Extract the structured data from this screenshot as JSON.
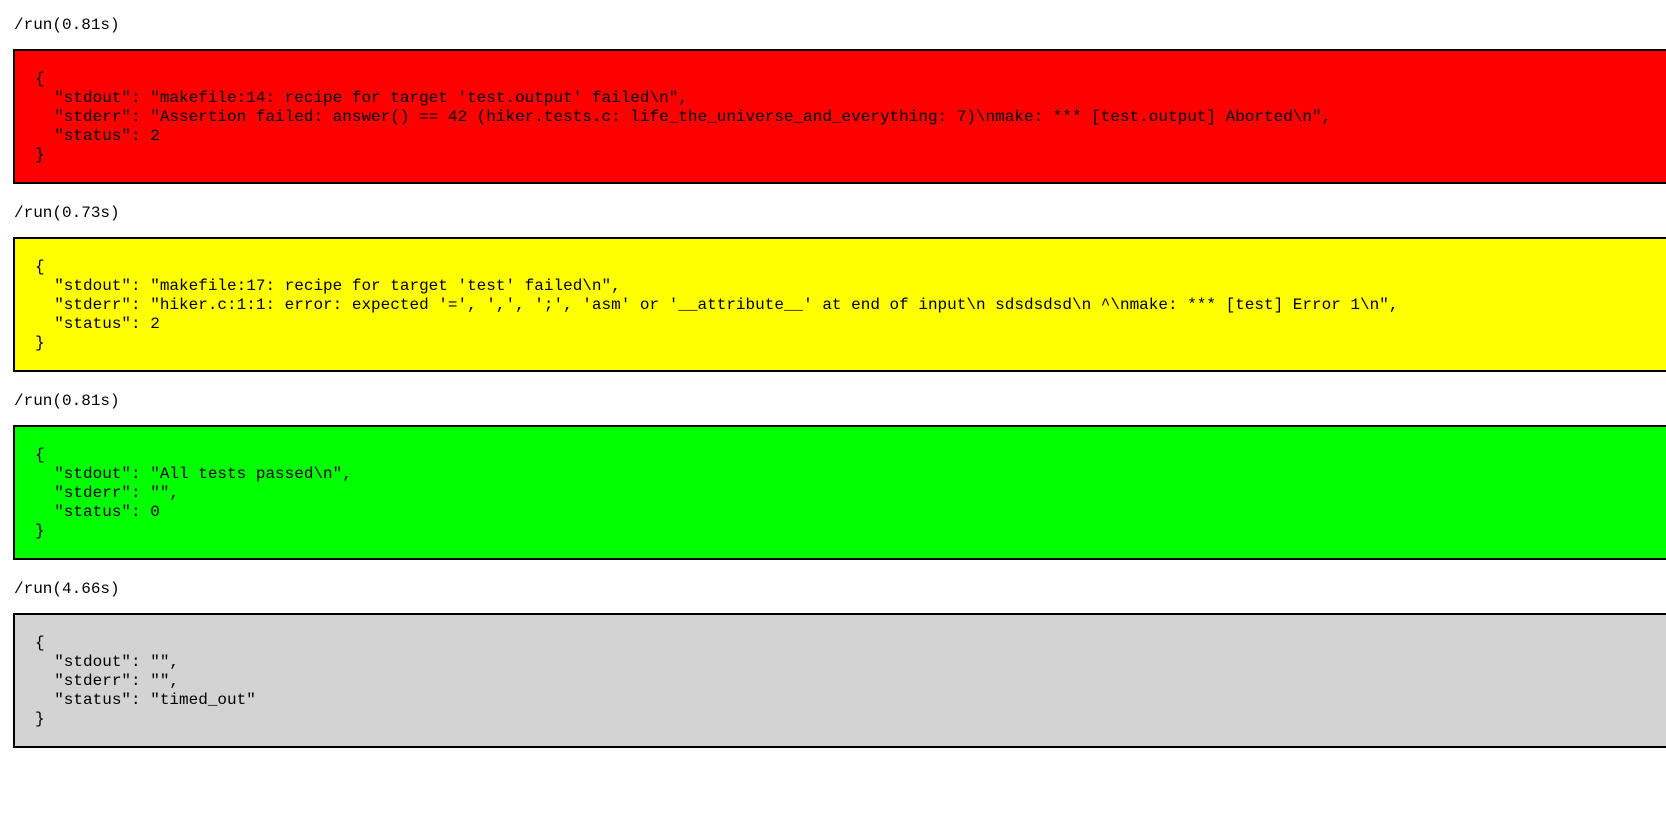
{
  "runs": [
    {
      "label": "/run(0.81s)",
      "color": "#ff0000",
      "lines": [
        "{",
        "  \"stdout\": \"makefile:14: recipe for target 'test.output' failed\\n\",",
        "  \"stderr\": \"Assertion failed: answer() == 42 (hiker.tests.c: life_the_universe_and_everything: 7)\\nmake: *** [test.output] Aborted\\n\",",
        "  \"status\": 2",
        "}"
      ]
    },
    {
      "label": "/run(0.73s)",
      "color": "#ffff00",
      "lines": [
        "{",
        "  \"stdout\": \"makefile:17: recipe for target 'test' failed\\n\",",
        "  \"stderr\": \"hiker.c:1:1: error: expected '=', ',', ';', 'asm' or '__attribute__' at end of input\\n sdsdsdsd\\n ^\\nmake: *** [test] Error 1\\n\",",
        "  \"status\": 2",
        "}"
      ]
    },
    {
      "label": "/run(0.81s)",
      "color": "#00ff00",
      "lines": [
        "{",
        "  \"stdout\": \"All tests passed\\n\",",
        "  \"stderr\": \"\",",
        "  \"status\": 0",
        "}"
      ]
    },
    {
      "label": "/run(4.66s)",
      "color": "#d3d3d3",
      "lines": [
        "{",
        "  \"stdout\": \"\",",
        "  \"stderr\": \"\",",
        "  \"status\": \"timed_out\"",
        "}"
      ]
    }
  ]
}
